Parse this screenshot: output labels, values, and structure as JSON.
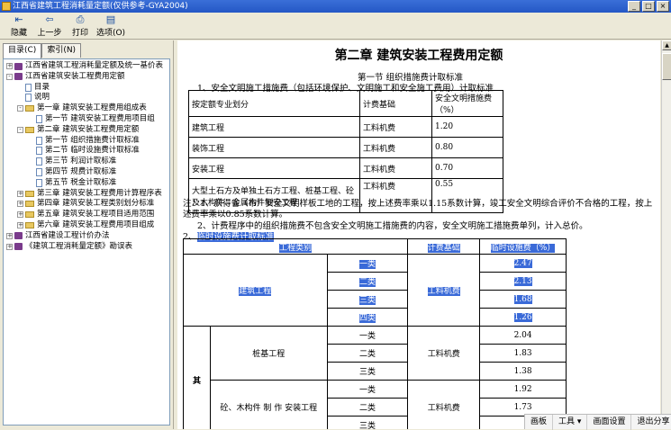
{
  "window": {
    "title": "江西省建筑工程消耗量定额(仅供参考-GYA2004)"
  },
  "toolbar": {
    "items": [
      {
        "label": "隐藏",
        "icon": "hide-icon"
      },
      {
        "label": "上一步",
        "icon": "back-icon"
      },
      {
        "label": "打印",
        "icon": "print-icon"
      },
      {
        "label": "选项(O)",
        "icon": "options-icon"
      }
    ]
  },
  "sidebar": {
    "tabs": [
      "目录(C)",
      "索引(N)"
    ],
    "tree": [
      {
        "label": "江西省建筑工程消耗量定额及统一基价表",
        "level": 0,
        "type": "book",
        "exp": "+"
      },
      {
        "label": "江西省建筑安装工程费用定额",
        "level": 0,
        "type": "book",
        "exp": "-"
      },
      {
        "label": "目录",
        "level": 1,
        "type": "page"
      },
      {
        "label": "说明",
        "level": 1,
        "type": "page"
      },
      {
        "label": "第一章  建筑安装工程费用组成表",
        "level": 1,
        "type": "folder",
        "exp": "-"
      },
      {
        "label": "第一节  建筑安装工程费用项目组",
        "level": 2,
        "type": "page"
      },
      {
        "label": "第二章  建筑安装工程费用定额",
        "level": 1,
        "type": "folder",
        "exp": "-"
      },
      {
        "label": "第一节  组织措施费计取标准",
        "level": 2,
        "type": "page"
      },
      {
        "label": "第二节  临时设施费计取标准",
        "level": 2,
        "type": "page"
      },
      {
        "label": "第三节  利润计取标准",
        "level": 2,
        "type": "page"
      },
      {
        "label": "第四节  规费计取标准",
        "level": 2,
        "type": "page"
      },
      {
        "label": "第五节  税金计取标准",
        "level": 2,
        "type": "page"
      },
      {
        "label": "第三章  建筑安装工程费用计算程序表",
        "level": 1,
        "type": "folder",
        "exp": "+"
      },
      {
        "label": "第四章  建筑安装工程类别划分标准",
        "level": 1,
        "type": "folder",
        "exp": "+"
      },
      {
        "label": "第五章  建筑安装工程项目适用范围",
        "level": 1,
        "type": "folder",
        "exp": "+"
      },
      {
        "label": "第六章  建筑安装工程费用项目组成",
        "level": 1,
        "type": "folder",
        "exp": "+"
      },
      {
        "label": "江西省建设工程计价办法",
        "level": 0,
        "type": "book",
        "exp": "+"
      },
      {
        "label": "《建筑工程消耗量定额》勘误表",
        "level": 0,
        "type": "book",
        "exp": "+"
      }
    ]
  },
  "doc": {
    "chapter_title": "第二章   建筑安装工程费用定额",
    "section_title": "第一节     组织措施费计取标准",
    "para1": "1、安全文明施工措施费（包括环境保护、文明施工和安全施工费用）计取标准",
    "table1": {
      "headers": [
        "按定额专业划分",
        "计费基础",
        "安全文明措施费（%）"
      ],
      "rows": [
        [
          "建筑工程",
          "工料机费",
          "1.20"
        ],
        [
          "装饰工程",
          "工料机费",
          "0.80"
        ],
        [
          "安装工程",
          "工料机费",
          "0.70"
        ],
        [
          "大型土石方及单独土石方工程、桩基工程、砼及木构件、金属构件制安工程",
          "工料机费",
          "0.55"
        ]
      ]
    },
    "note1a": "注：1、获得省（市）安全文明样板工地的工程，按上述费率乘以1.15系数计算，竣工安全文明综合评价不合格的工程，按上",
    "note1b": "述费率乘以0.85系数计算。",
    "note2": "2、计费程序中的组织措施费不包含安全文明施工措施费的内容，安全文明施工措施费单列，计入总价。",
    "para2_prefix": "2、",
    "para2": "临时设施费计取标准",
    "table2": {
      "headers": [
        "工程类别",
        "计费基础",
        "临时设施费（%）"
      ],
      "group1": {
        "name": "建筑工程",
        "base": "工料机费",
        "rows": [
          [
            "一类",
            "2.47"
          ],
          [
            "二类",
            "2.13"
          ],
          [
            "三类",
            "1.68"
          ],
          [
            "四类",
            "1.26"
          ]
        ]
      },
      "side_label": "其",
      "group2": {
        "name": "桩基工程",
        "base": "工料机费",
        "rows": [
          [
            "一类",
            "2.04"
          ],
          [
            "二类",
            "1.83"
          ],
          [
            "三类",
            "1.38"
          ]
        ]
      },
      "group3": {
        "name": "砼、木构件 制 作 安装工程",
        "base": "工料机费",
        "rows": [
          [
            "一类",
            "1.92"
          ],
          [
            "二类",
            "1.73"
          ],
          [
            "三类",
            ""
          ]
        ]
      }
    }
  },
  "taskbar": {
    "items": [
      "画板",
      "工具",
      "画面设置",
      "退出分享"
    ]
  }
}
